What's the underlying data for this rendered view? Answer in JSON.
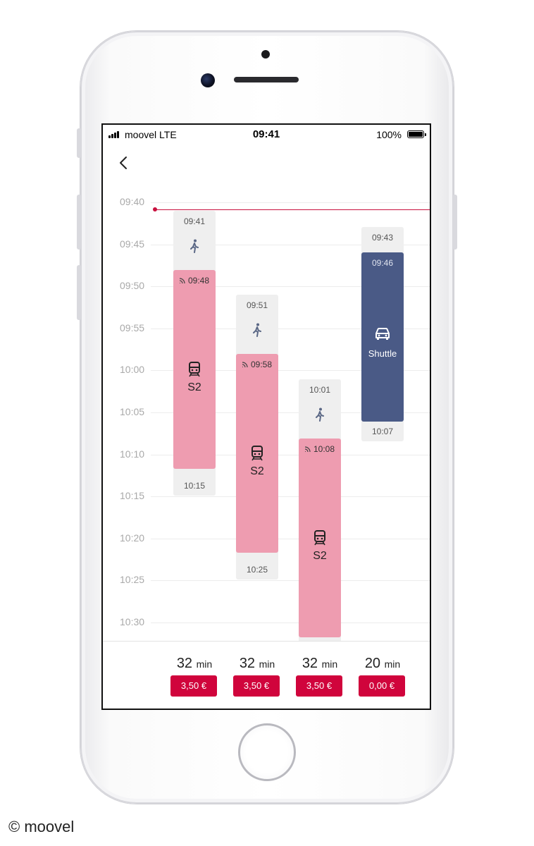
{
  "status_bar": {
    "carrier": "moovel LTE",
    "time": "09:41",
    "battery": "100%"
  },
  "timeline": {
    "ticks": [
      "09:40",
      "09:45",
      "09:50",
      "09:55",
      "10:00",
      "10:05",
      "10:10",
      "10:15",
      "10:20",
      "10:25",
      "10:30"
    ]
  },
  "options": [
    {
      "walk_start": "09:41",
      "ride_start": "09:48",
      "line": "S2",
      "end": "10:15",
      "duration": "32",
      "unit": "min",
      "price": "3,50 €"
    },
    {
      "walk_start": "09:51",
      "ride_start": "09:58",
      "line": "S2",
      "end": "10:25",
      "duration": "32",
      "unit": "min",
      "price": "3,50 €"
    },
    {
      "walk_start": "10:01",
      "ride_start": "10:08",
      "line": "S2",
      "duration": "32",
      "unit": "min",
      "price": "3,50 €"
    },
    {
      "walk_start": "09:43",
      "ride_start": "09:46",
      "line": "Shuttle",
      "end": "10:07",
      "duration": "20",
      "unit": "min",
      "price": "0,00 €"
    }
  ],
  "colors": {
    "accent": "#d0043c",
    "train": "#ee9cb0",
    "shuttle": "#4a5a86",
    "walk": "#efefef",
    "now_line": "#c8103e"
  },
  "icons": {
    "back": "chevron-left-icon",
    "walk": "walking-person-icon",
    "train": "train-icon",
    "shuttle": "car-icon",
    "realtime": "realtime-signal-icon"
  },
  "copyright": "© moovel"
}
